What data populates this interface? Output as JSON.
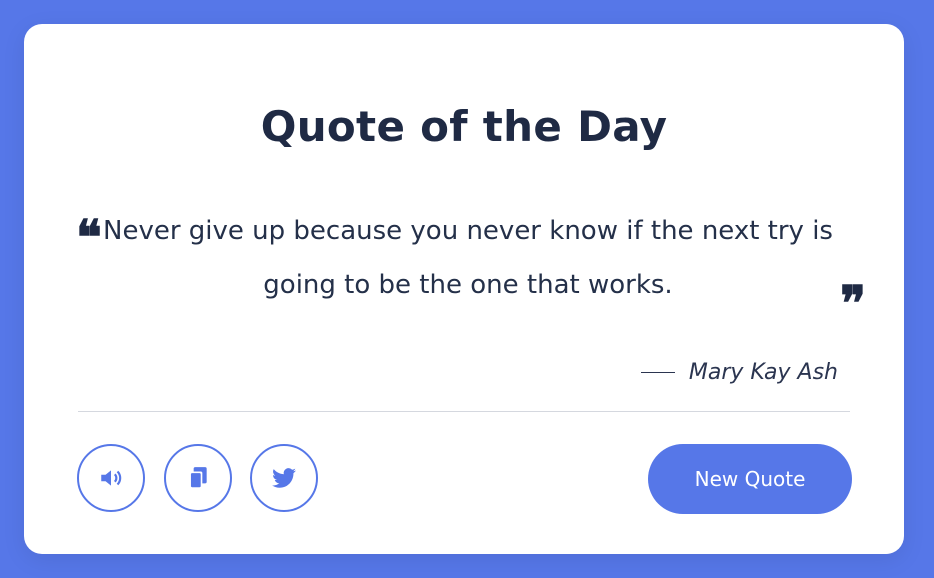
{
  "card": {
    "title": "Quote of the Day",
    "quote": "Never give up because you never know if the next try is going to be the one that works.",
    "author": "Mary Kay Ash",
    "author_dash": "—"
  },
  "actions": {
    "speak_icon": "speaker-icon",
    "copy_icon": "copy-icon",
    "tweet_icon": "twitter-icon",
    "new_quote_label": "New Quote"
  },
  "colors": {
    "background": "#5677e8",
    "accent": "#5677e8",
    "text": "#1f2a44"
  }
}
